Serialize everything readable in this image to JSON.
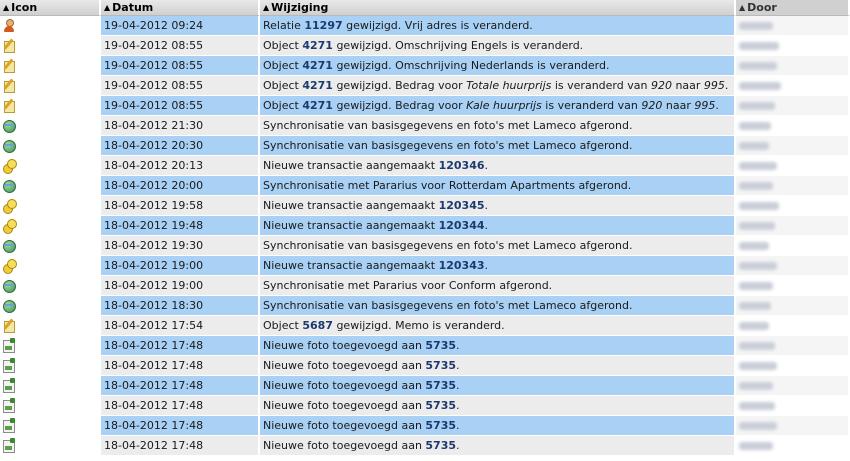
{
  "headers": {
    "icon": "Icon",
    "date": "Datum",
    "change": "Wijziging",
    "by": "Door"
  },
  "colors": {
    "row_highlight": "#a9d1f6",
    "row_plain": "#ececec",
    "bold_text": "#1d3a6e"
  },
  "rows": [
    {
      "icon": "user-icon",
      "date": "19-04-2012 09:24",
      "parts": [
        "Relatie ",
        "11297",
        " gewijzigd. Vrij adres is veranderd."
      ]
    },
    {
      "icon": "edit-icon",
      "date": "19-04-2012 08:55",
      "parts": [
        "Object ",
        "4271",
        " gewijzigd. Omschrijving Engels is veranderd."
      ]
    },
    {
      "icon": "edit-icon",
      "date": "19-04-2012 08:55",
      "parts": [
        "Object ",
        "4271",
        " gewijzigd. Omschrijving Nederlands is veranderd."
      ]
    },
    {
      "icon": "edit-icon",
      "date": "19-04-2012 08:55",
      "parts": [
        "Object ",
        "4271",
        " gewijzigd. Bedrag voor ",
        "Totale huurprijs",
        " is veranderd van ",
        "920",
        " naar ",
        "995",
        "."
      ]
    },
    {
      "icon": "edit-icon",
      "date": "19-04-2012 08:55",
      "parts": [
        "Object ",
        "4271",
        " gewijzigd. Bedrag voor ",
        "Kale huurprijs",
        " is veranderd van ",
        "920",
        " naar ",
        "995",
        "."
      ]
    },
    {
      "icon": "sync-icon",
      "date": "18-04-2012 21:30",
      "parts": [
        "Synchronisatie van basisgegevens en foto's met Lameco afgerond."
      ]
    },
    {
      "icon": "sync-icon",
      "date": "18-04-2012 20:30",
      "parts": [
        "Synchronisatie van basisgegevens en foto's met Lameco afgerond."
      ]
    },
    {
      "icon": "transaction-icon",
      "date": "18-04-2012 20:13",
      "parts": [
        "Nieuwe transactie aangemaakt ",
        "120346",
        "."
      ]
    },
    {
      "icon": "sync-icon",
      "date": "18-04-2012 20:00",
      "parts": [
        "Synchronisatie met Pararius voor Rotterdam Apartments afgerond."
      ]
    },
    {
      "icon": "transaction-icon",
      "date": "18-04-2012 19:58",
      "parts": [
        "Nieuwe transactie aangemaakt ",
        "120345",
        "."
      ]
    },
    {
      "icon": "transaction-icon",
      "date": "18-04-2012 19:48",
      "parts": [
        "Nieuwe transactie aangemaakt ",
        "120344",
        "."
      ]
    },
    {
      "icon": "sync-icon",
      "date": "18-04-2012 19:30",
      "parts": [
        "Synchronisatie van basisgegevens en foto's met Lameco afgerond."
      ]
    },
    {
      "icon": "transaction-icon",
      "date": "18-04-2012 19:00",
      "parts": [
        "Nieuwe transactie aangemaakt ",
        "120343",
        "."
      ]
    },
    {
      "icon": "sync-icon",
      "date": "18-04-2012 19:00",
      "parts": [
        "Synchronisatie met Pararius voor Conform afgerond."
      ]
    },
    {
      "icon": "sync-icon",
      "date": "18-04-2012 18:30",
      "parts": [
        "Synchronisatie van basisgegevens en foto's met Lameco afgerond."
      ]
    },
    {
      "icon": "edit-icon",
      "date": "18-04-2012 17:54",
      "parts": [
        "Object ",
        "5687",
        " gewijzigd. Memo is veranderd."
      ]
    },
    {
      "icon": "photo-icon",
      "date": "18-04-2012 17:48",
      "parts": [
        "Nieuwe foto toegevoegd aan ",
        "5735",
        "."
      ]
    },
    {
      "icon": "photo-icon",
      "date": "18-04-2012 17:48",
      "parts": [
        "Nieuwe foto toegevoegd aan ",
        "5735",
        "."
      ]
    },
    {
      "icon": "photo-icon",
      "date": "18-04-2012 17:48",
      "parts": [
        "Nieuwe foto toegevoegd aan ",
        "5735",
        "."
      ]
    },
    {
      "icon": "photo-icon",
      "date": "18-04-2012 17:48",
      "parts": [
        "Nieuwe foto toegevoegd aan ",
        "5735",
        "."
      ]
    },
    {
      "icon": "photo-icon",
      "date": "18-04-2012 17:48",
      "parts": [
        "Nieuwe foto toegevoegd aan ",
        "5735",
        "."
      ]
    },
    {
      "icon": "photo-icon",
      "date": "18-04-2012 17:48",
      "parts": [
        "Nieuwe foto toegevoegd aan ",
        "5735",
        "."
      ]
    }
  ]
}
